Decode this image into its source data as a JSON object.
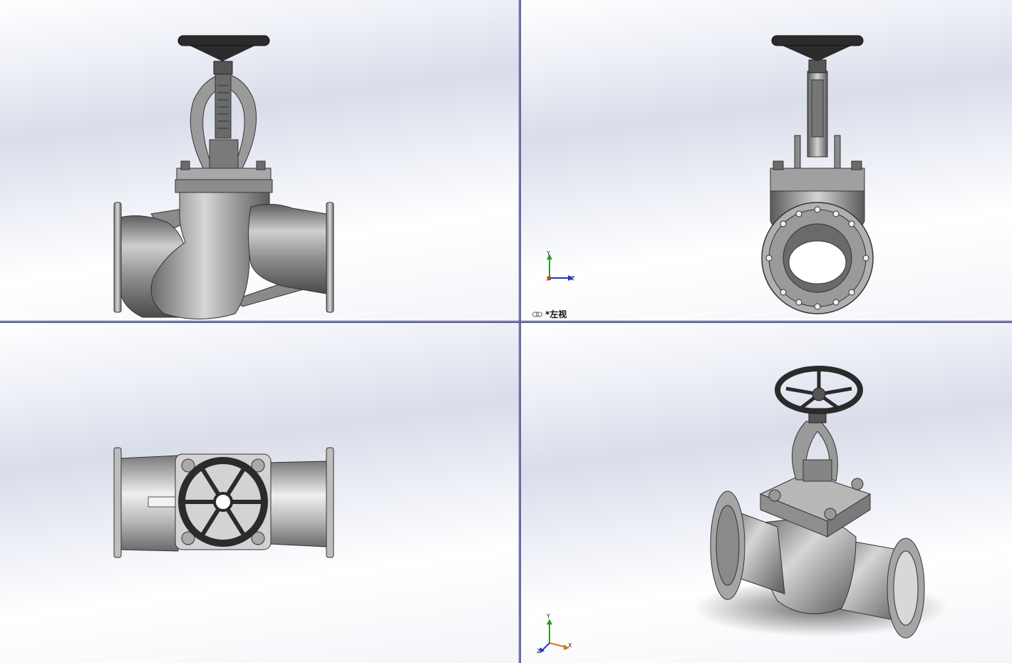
{
  "viewports": [
    {
      "id": "front",
      "label": ""
    },
    {
      "id": "left",
      "label": "*左视"
    },
    {
      "id": "top",
      "label": ""
    },
    {
      "id": "iso",
      "label": ""
    }
  ],
  "triad_axes": {
    "left": {
      "up": "Y",
      "right": "Z",
      "origin": "X"
    },
    "iso": {
      "up": "Y",
      "right": "X",
      "origin": "Z"
    }
  },
  "colors": {
    "divider": "#1f2a74",
    "metal_light": "#c9c9c9",
    "metal_dark": "#5a5a5a",
    "handwheel": "#2b2b2b",
    "axis_x": "#d23a1a",
    "axis_y": "#2a9a2a",
    "axis_z": "#2233cc"
  },
  "icons": [
    "link-icon",
    "triad-icon"
  ]
}
